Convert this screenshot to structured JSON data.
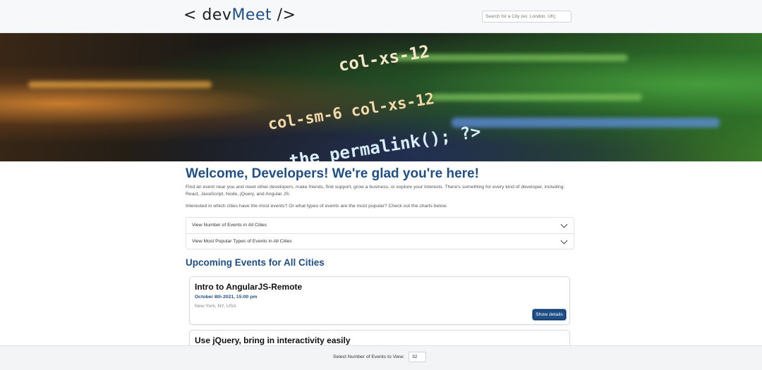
{
  "header": {
    "logo_left": "< dev",
    "logo_accent": "Meet",
    "logo_right": " />",
    "city_search_placeholder": "Search for a City (ex: London, UK)",
    "city_search_value": ""
  },
  "hero": {
    "code_lines": [
      "col-xs-12",
      "col-sm-6  col-xs-12",
      "the_permalink();  ?>"
    ]
  },
  "welcome": {
    "title": "Welcome, Developers! We're glad you're here!",
    "intro": "Find an event near you and meet other developers, make friends, find support, grow a business, or explore your interests. There's something for every kind of developer, including: React, JavaScript, Node, jQuery, and Angular JS.",
    "question": "Interested in which cities have the most events? Or what types of events are the most popular? Check out the charts below."
  },
  "accordion": {
    "items": [
      {
        "label": "View Number of Events in All Cities"
      },
      {
        "label": "View Most Popular Types of Events in All Cities"
      }
    ]
  },
  "events": {
    "heading": "Upcoming Events for All Cities",
    "list": [
      {
        "title": "Intro to AngularJS-Remote",
        "date": "October 8th 2021, 15:00 pm",
        "location": "New York, NY, USA",
        "button": "Show details"
      },
      {
        "title": "Use jQuery, bring in interactivity easily"
      }
    ]
  },
  "footer": {
    "label": "Select Number of Events to View:",
    "count": "32"
  },
  "colors": {
    "accent": "#1e4f86",
    "navbar": "#f7f8fa"
  }
}
